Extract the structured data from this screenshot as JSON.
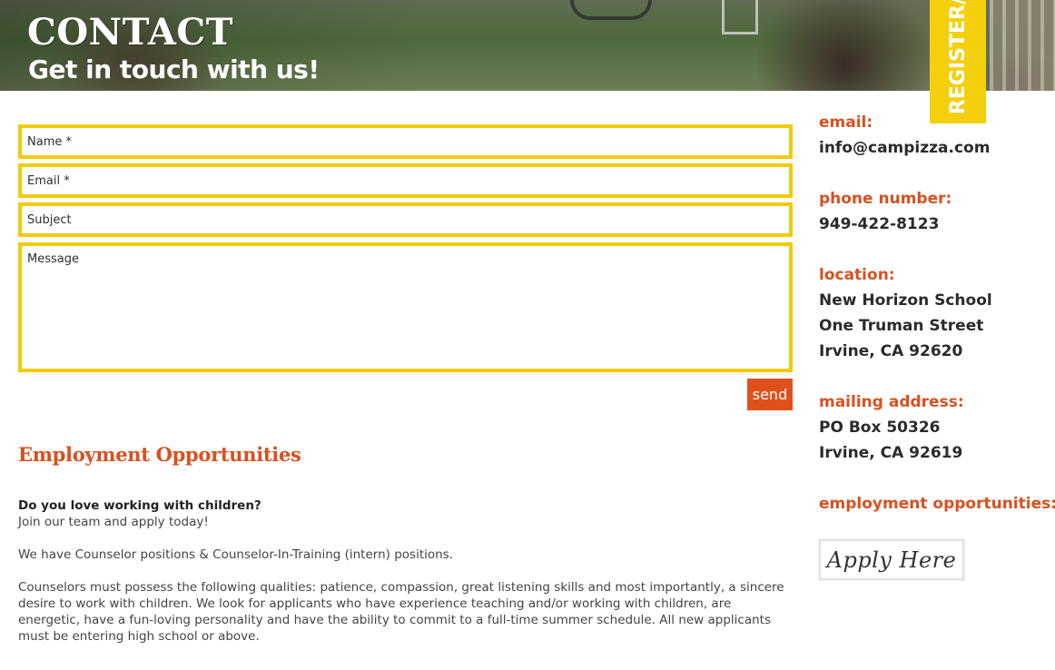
{
  "header": {
    "title": "CONTACT",
    "subtitle": "Get in touch with us!",
    "register_label": "REGISTER/"
  },
  "form": {
    "name_placeholder": "Name *",
    "email_placeholder": "Email *",
    "subject_placeholder": "Subject",
    "message_placeholder": "Message",
    "send_label": "send"
  },
  "employment": {
    "heading": "Employment Opportunities",
    "question": "Do you love working with children?",
    "join": "Join our team and apply today!",
    "positions": "We have Counselor positions & Counselor-In-Training (intern) positions.",
    "qualities": "Counselors must possess the following qualities: patience, compassion, great listening skills and most importantly, a sincere desire to work with children. We look for applicants who have experience teaching and/or working with children, are energetic, have a fun-loving personality and have the ability to commit to a full-time summer schedule. All new applicants must be entering high school or above."
  },
  "sidebar": {
    "email_label": "email:",
    "email_value": "info@campizza.com",
    "phone_label": "phone number:",
    "phone_value": "949-422-8123",
    "location_label": "location:",
    "location_lines": [
      "New Horizon School",
      "One Truman Street",
      "Irvine, CA 92620"
    ],
    "mailing_label": "mailing address:",
    "mailing_lines": [
      "PO Box 50326",
      "Irvine, CA 92619"
    ],
    "employment_label": "employment opportunities:",
    "apply_label": "Apply Here"
  },
  "colors": {
    "accent_orange": "#e0501d",
    "accent_yellow": "#f2cb0c"
  }
}
